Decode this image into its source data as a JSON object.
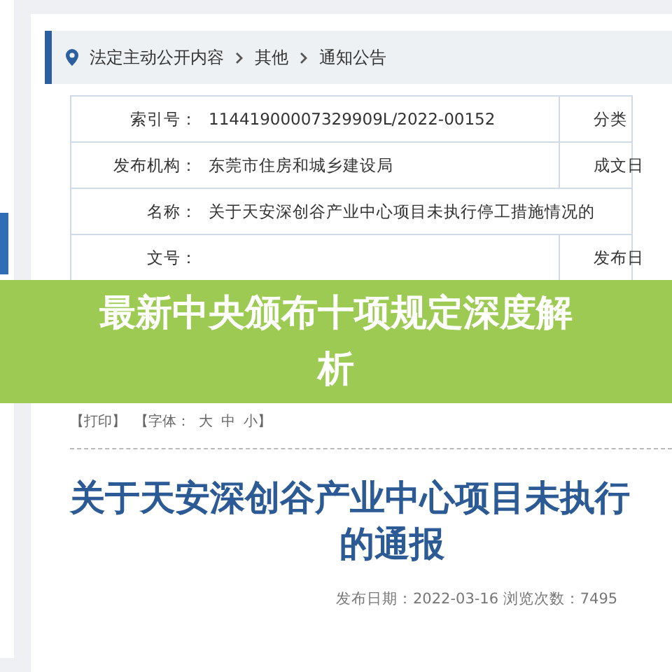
{
  "breadcrumb": [
    "法定主动公开内容",
    "其他",
    "通知公告"
  ],
  "info_table": [
    {
      "label": "索引号：",
      "value": "11441900007329909L/2022-00152",
      "label_2": "分类"
    },
    {
      "label": "发布机构：",
      "value": "东莞市住房和城乡建设局",
      "label_2": "成文日"
    },
    {
      "label": "名称：",
      "value": "关于天安深创谷产业中心项目未执行停工措施情况的"
    },
    {
      "label": "文号：",
      "label_2": "发布日"
    }
  ],
  "tools": [
    "【打印】",
    "【字体：",
    "大",
    "中",
    "小】"
  ],
  "article": {
    "title_line_1": "关于天安深创谷产业中心项目未执行",
    "title_line_2": "的通报",
    "meta": "发布日期：2022-03-16  浏览次数：7495"
  },
  "banner": {
    "text": "最新中央颁布十项规定深度解析"
  }
}
